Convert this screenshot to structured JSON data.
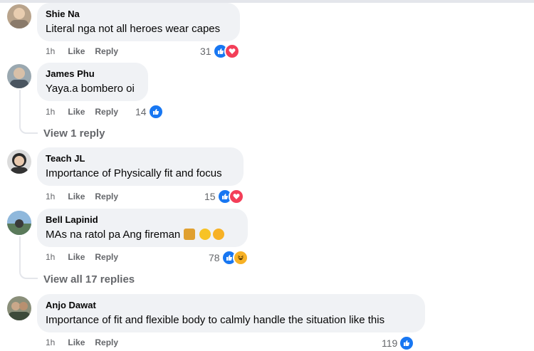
{
  "comments": [
    {
      "name": "Shie Na",
      "text": "Literal nga not all heroes wear capes",
      "time": "1h",
      "like": "Like",
      "reply": "Reply",
      "reactions": "31"
    },
    {
      "name": "James Phu",
      "text": "Yaya.a bombero oi",
      "time": "1h",
      "like": "Like",
      "reply": "Reply",
      "reactions": "14",
      "view_replies": "View 1 reply"
    },
    {
      "name": "Teach JL",
      "text": "Importance of Physically fit and focus",
      "time": "1h",
      "like": "Like",
      "reply": "Reply",
      "reactions": "15"
    },
    {
      "name": "Bell Lapinid",
      "text": "MAs na ratol pa Ang fireman",
      "time": "1h",
      "like": "Like",
      "reply": "Reply",
      "reactions": "78",
      "view_replies": "View all 17 replies"
    },
    {
      "name": "Anjo Dawat",
      "text": "Importance of fit and flexible body to calmly handle the situation like this",
      "time": "1h",
      "like": "Like",
      "reply": "Reply",
      "reactions": "119"
    }
  ],
  "colors": {
    "bubble": "#f0f2f5",
    "like": "#1877f2",
    "heart": "#f33e58",
    "haha": "#f7b125",
    "meta": "#65676b"
  }
}
